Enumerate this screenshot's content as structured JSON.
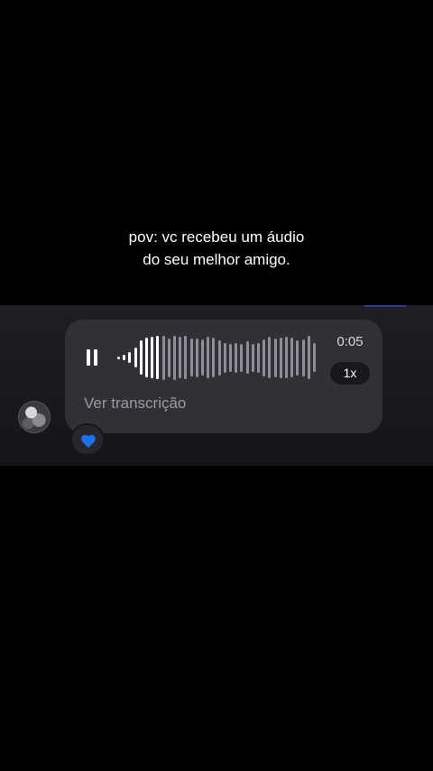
{
  "caption": {
    "line1": "pov: vc recebeu um áudio",
    "line2": "do seu melhor amigo."
  },
  "audio_message": {
    "state": "playing",
    "control_icon": "pause-icon",
    "duration": "0:05",
    "playback_speed": "1x",
    "transcript_link": "Ver transcrição",
    "waveform_levels": [
      0.05,
      0.12,
      0.22,
      0.4,
      0.7,
      0.82,
      0.86,
      0.88,
      0.9,
      0.8,
      0.9,
      0.86,
      0.88,
      0.78,
      0.8,
      0.74,
      0.86,
      0.82,
      0.72,
      0.62,
      0.58,
      0.62,
      0.58,
      0.66,
      0.58,
      0.62,
      0.76,
      0.86,
      0.8,
      0.84,
      0.86,
      0.82,
      0.72,
      0.76,
      0.88,
      0.6
    ],
    "played_fraction": 0.2,
    "reaction": "blue-heart-icon"
  },
  "colors": {
    "background": "#000000",
    "bubble": "#303036",
    "waveform_played": "#ffffff",
    "waveform_unplayed": "#8e8e96",
    "reaction_heart": "#1f6fe8"
  }
}
